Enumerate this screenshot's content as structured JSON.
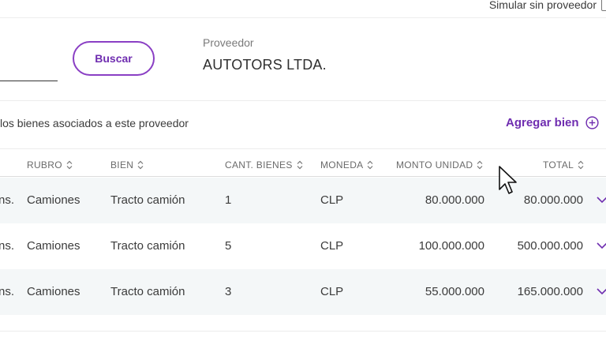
{
  "topbar": {
    "simulate_label": "Simular sin proveedor"
  },
  "search": {
    "button_label": "Buscar"
  },
  "provider": {
    "label": "Proveedor",
    "name": "AUTOTORS LTDA."
  },
  "goods": {
    "info_text": "los bienes asociados a este proveedor",
    "add_label": "Agregar bien"
  },
  "table": {
    "headers": {
      "rubro": "RUBRO",
      "bien": "BIEN",
      "cantidad": "CANT. BIENES",
      "moneda": "MONEDA",
      "monto": "MONTO UNIDAD",
      "total": "TOTAL"
    },
    "rows": [
      {
        "prefix": "ns.",
        "rubro": "Camiones",
        "bien": "Tracto camión",
        "cantidad": "1",
        "moneda": "CLP",
        "monto": "80.000.000",
        "total": "80.000.000"
      },
      {
        "prefix": "ns.",
        "rubro": "Camiones",
        "bien": "Tracto camión",
        "cantidad": "5",
        "moneda": "CLP",
        "monto": "100.000.000",
        "total": "500.000.000"
      },
      {
        "prefix": "ns.",
        "rubro": "Camiones",
        "bien": "Tracto camión",
        "cantidad": "3",
        "moneda": "CLP",
        "monto": "55.000.000",
        "total": "165.000.000"
      }
    ]
  },
  "icons": {
    "sort": "sort-updown-icon",
    "add": "plus-circle-icon",
    "expand": "chevron-down-icon",
    "cursor": "mouse-pointer-icon"
  },
  "colors": {
    "accent": "#6f2db0",
    "row_alt": "#f4f7f8"
  }
}
